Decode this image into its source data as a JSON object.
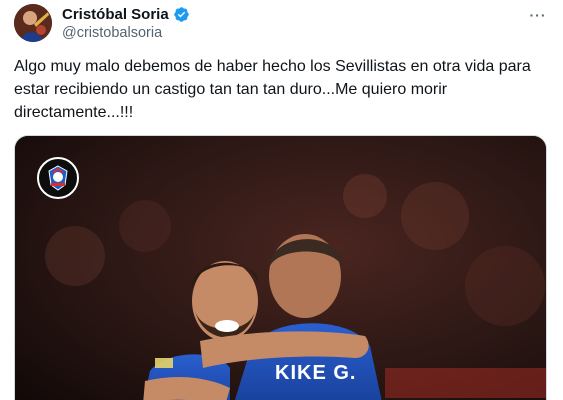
{
  "author": {
    "display_name": "Cristóbal Soria",
    "handle": "@cristobalsoria",
    "verified": true,
    "avatar_icon": "user-avatar"
  },
  "actions": {
    "more_icon": "more-horizontal-icon",
    "more_label": "···"
  },
  "tweet": {
    "text": "Algo muy malo debemos de haber hecho los Sevillistas en otra vida para\nestar recibiendo un castigo tan tan tan duro...Me quiero morir\ndirectamente...!!!"
  },
  "media": {
    "type": "photo",
    "jersey_text": "KIKE G."
  },
  "colors": {
    "verified": "#1d9bf0",
    "text_primary": "#0f1419",
    "text_secondary": "#536471",
    "jersey": "#1f4fb8"
  }
}
